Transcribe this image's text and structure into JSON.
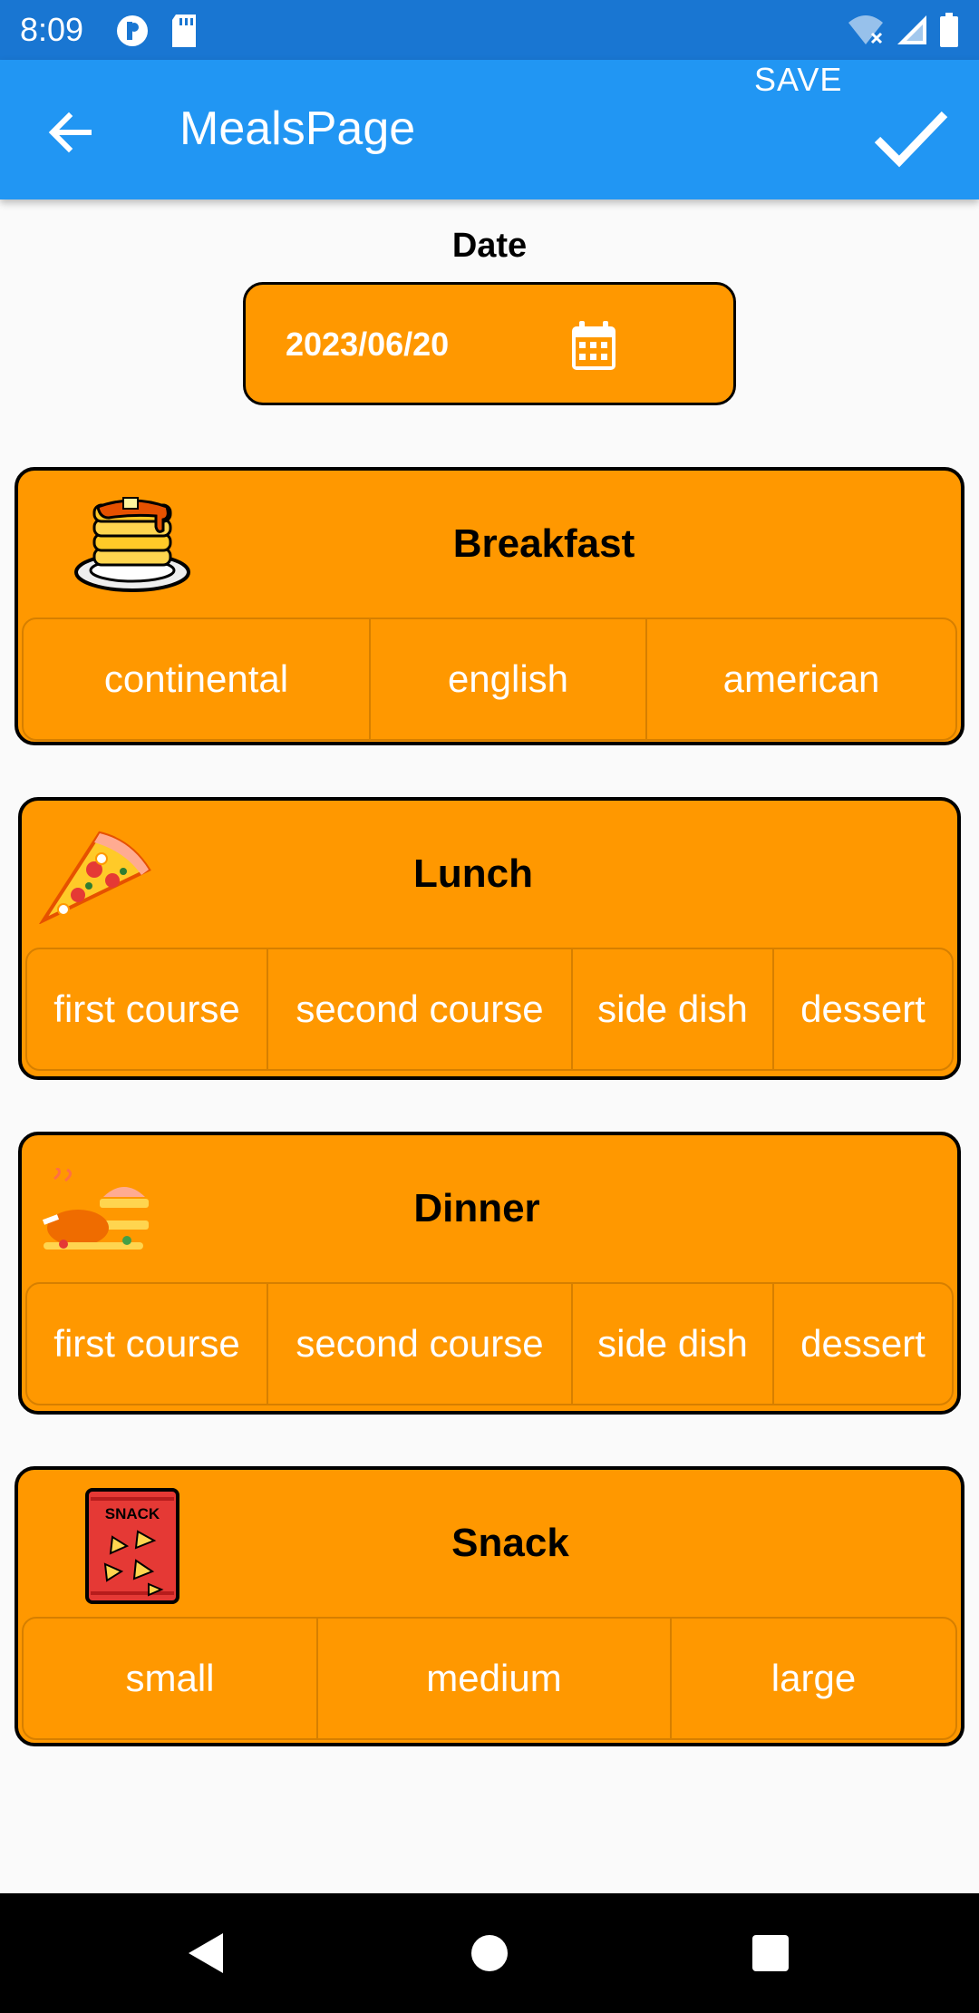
{
  "status_bar": {
    "time": "8:09",
    "icons": [
      "p-badge-icon",
      "sd-card-icon",
      "wifi-off-icon",
      "signal-icon",
      "battery-icon"
    ]
  },
  "app_bar": {
    "title": "MealsPage",
    "save_label": "SAVE",
    "icons": [
      "back-arrow-icon",
      "checkmark-icon"
    ]
  },
  "date": {
    "label": "Date",
    "value": "2023/06/20",
    "icon": "calendar-icon"
  },
  "meals": [
    {
      "title": "Breakfast",
      "icon": "pancakes-icon",
      "options": [
        "continental",
        "english",
        "american"
      ]
    },
    {
      "title": "Lunch",
      "icon": "pizza-icon",
      "options": [
        "first course",
        "second course",
        "side dish",
        "dessert"
      ]
    },
    {
      "title": "Dinner",
      "icon": "roast-chicken-icon",
      "options": [
        "first course",
        "second course",
        "side dish",
        "dessert"
      ]
    },
    {
      "title": "Snack",
      "icon": "snack-bag-icon",
      "options": [
        "small",
        "medium",
        "large"
      ],
      "icon_text": "SNACK"
    }
  ],
  "nav_bar": {
    "icons": [
      "back-triangle-icon",
      "home-circle-icon",
      "recents-square-icon"
    ]
  },
  "colors": {
    "status_bar": "#1976d2",
    "app_bar": "#2196f3",
    "accent": "#ff9800",
    "background": "#fafafa"
  }
}
